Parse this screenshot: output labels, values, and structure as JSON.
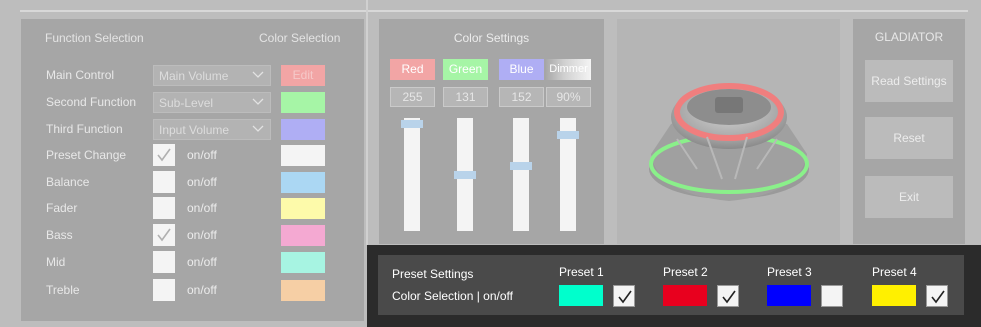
{
  "function_panel": {
    "header_left": "Function Selection",
    "header_right": "Color Selection",
    "rows": [
      {
        "label": "Main Control",
        "kind": "select",
        "value": "Main Volume",
        "swatch": "edit",
        "swatch_label": "Edit",
        "color": "#f2a5a5"
      },
      {
        "label": "Second Function",
        "kind": "select",
        "value": "Sub-Level",
        "color": "#a6f5a6"
      },
      {
        "label": "Third Function",
        "kind": "select",
        "value": "Input Volume",
        "color": "#afaef4"
      },
      {
        "label": "Preset Change",
        "kind": "check",
        "checked": true,
        "text": "on/off",
        "color": "#f4f4f4"
      },
      {
        "label": "Balance",
        "kind": "check",
        "checked": false,
        "text": "on/off",
        "color": "#abd7f3"
      },
      {
        "label": "Fader",
        "kind": "check",
        "checked": false,
        "text": "on/off",
        "color": "#fdfaaa"
      },
      {
        "label": "Bass",
        "kind": "check",
        "checked": true,
        "text": "on/off",
        "color": "#f4a9d2"
      },
      {
        "label": "Mid",
        "kind": "check",
        "checked": false,
        "text": "on/off",
        "color": "#a7f4e2"
      },
      {
        "label": "Treble",
        "kind": "check",
        "checked": false,
        "text": "on/off",
        "color": "#f6cfa5"
      }
    ]
  },
  "color_settings": {
    "title": "Color Settings",
    "channels": [
      {
        "name": "Red",
        "value": "255",
        "level": 1.0,
        "color": "#f2a5a5"
      },
      {
        "name": "Green",
        "value": "131",
        "level": 0.514,
        "color": "#a6f5a6"
      },
      {
        "name": "Blue",
        "value": "152",
        "level": 0.596,
        "color": "#afaef4"
      },
      {
        "name": "Dimmer",
        "value": "90%",
        "level": 0.9,
        "color": "#a6a6a6"
      }
    ]
  },
  "gladiator": {
    "title": "GLADIATOR",
    "read_label": "Read Settings",
    "reset_label": "Reset",
    "exit_label": "Exit"
  },
  "preset_settings": {
    "title": "Preset Settings",
    "subtitle": "Color Selection | on/off",
    "presets": [
      {
        "label": "Preset 1",
        "color": "#00ffcc",
        "checked": true
      },
      {
        "label": "Preset 2",
        "color": "#e8001e",
        "checked": true
      },
      {
        "label": "Preset 3",
        "color": "#0000ff",
        "checked": false
      },
      {
        "label": "Preset 4",
        "color": "#fff000",
        "checked": true
      }
    ]
  }
}
